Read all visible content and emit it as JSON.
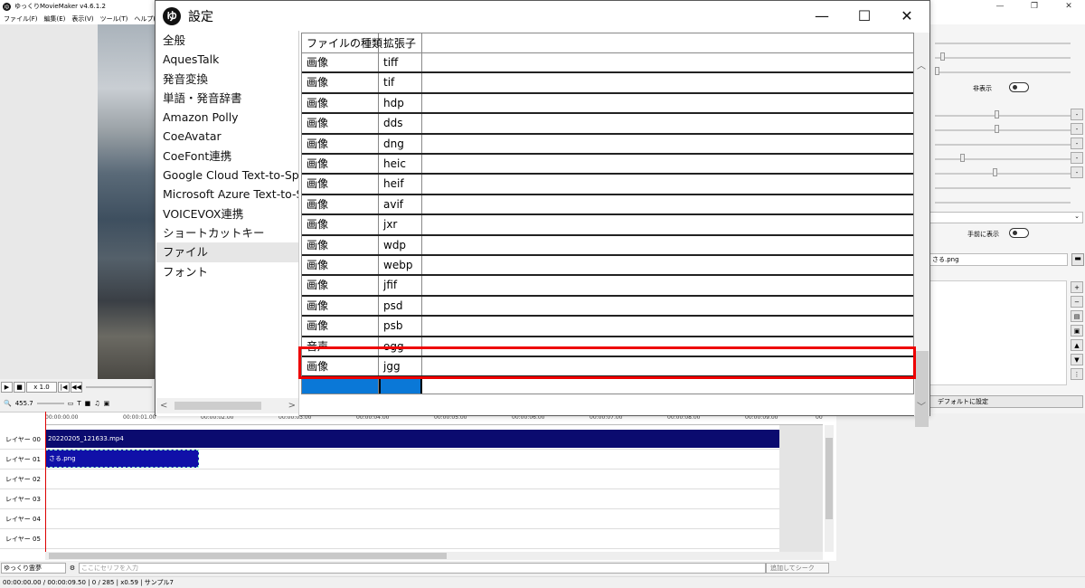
{
  "app": {
    "title": "ゆっくりMovieMaker v4.6.1.2",
    "menu": [
      "ファイル(F)",
      "編集(E)",
      "表示(V)",
      "ツール(T)",
      "ヘルプ(H)"
    ],
    "window_controls": [
      "—",
      "❐",
      "✕"
    ]
  },
  "player": {
    "play_icon": "▶",
    "stop_icon": "■",
    "speed": "x 1.0",
    "zoom": "455.7"
  },
  "timeline": {
    "ticks": [
      "00:00:00.00",
      "00:00:01.00",
      "00:00:02.00",
      "00:00:03.00",
      "00:00:04.00",
      "00:00:05.00",
      "00:00:06.00",
      "00:00:07.00",
      "00:00:08.00",
      "00:00:09.00",
      "00"
    ],
    "layers": [
      "レイヤー 00",
      "レイヤー 01",
      "レイヤー 02",
      "レイヤー 03",
      "レイヤー 04",
      "レイヤー 05"
    ],
    "clips": {
      "video": "20220205_121633.mp4",
      "image": "さる.png"
    }
  },
  "speech": {
    "character": "ゆっくり霊夢",
    "placeholder": "ここにセリフを入力",
    "add_button": "追加してシーク"
  },
  "status": {
    "text": "00:00:00.00  /  00:00:09.50 |  0  /  285  |  x0.59  |  サンプル7"
  },
  "right_panel": {
    "hide_label": "非表示",
    "front_label": "手前に表示",
    "file_value": "さる.png",
    "default_button": "デフォルトに設定"
  },
  "dialog": {
    "logo": "ゆ",
    "title": "設定",
    "controls": {
      "minimize": "—",
      "maximize": "☐",
      "close": "✕"
    },
    "nav": [
      {
        "label": "全般",
        "selected": false
      },
      {
        "label": "AquesTalk",
        "selected": false
      },
      {
        "label": "発音変換",
        "selected": false
      },
      {
        "label": "単語・発音辞書",
        "selected": false
      },
      {
        "label": "Amazon Polly",
        "selected": false
      },
      {
        "label": "CoeAvatar",
        "selected": false
      },
      {
        "label": "CoeFont連携",
        "selected": false
      },
      {
        "label": "Google Cloud Text-to-Speech",
        "selected": false
      },
      {
        "label": "Microsoft Azure Text-to-Speech",
        "selected": false
      },
      {
        "label": "VOICEVOX連携",
        "selected": false
      },
      {
        "label": "ショートカットキー",
        "selected": false
      },
      {
        "label": "ファイル",
        "selected": true
      },
      {
        "label": "フォント",
        "selected": false
      }
    ],
    "grid": {
      "headers": [
        "ファイルの種類",
        "拡張子"
      ],
      "rows": [
        {
          "type": "画像",
          "ext": "tiff"
        },
        {
          "type": "画像",
          "ext": "tif"
        },
        {
          "type": "画像",
          "ext": "hdp"
        },
        {
          "type": "画像",
          "ext": "dds"
        },
        {
          "type": "画像",
          "ext": "dng"
        },
        {
          "type": "画像",
          "ext": "heic"
        },
        {
          "type": "画像",
          "ext": "heif"
        },
        {
          "type": "画像",
          "ext": "avif"
        },
        {
          "type": "画像",
          "ext": "jxr"
        },
        {
          "type": "画像",
          "ext": "wdp"
        },
        {
          "type": "画像",
          "ext": "webp"
        },
        {
          "type": "画像",
          "ext": "jfif"
        },
        {
          "type": "画像",
          "ext": "psd"
        },
        {
          "type": "画像",
          "ext": "psb"
        },
        {
          "type": "音声",
          "ext": "ogg"
        },
        {
          "type": "画像",
          "ext": "jgg"
        }
      ]
    }
  }
}
